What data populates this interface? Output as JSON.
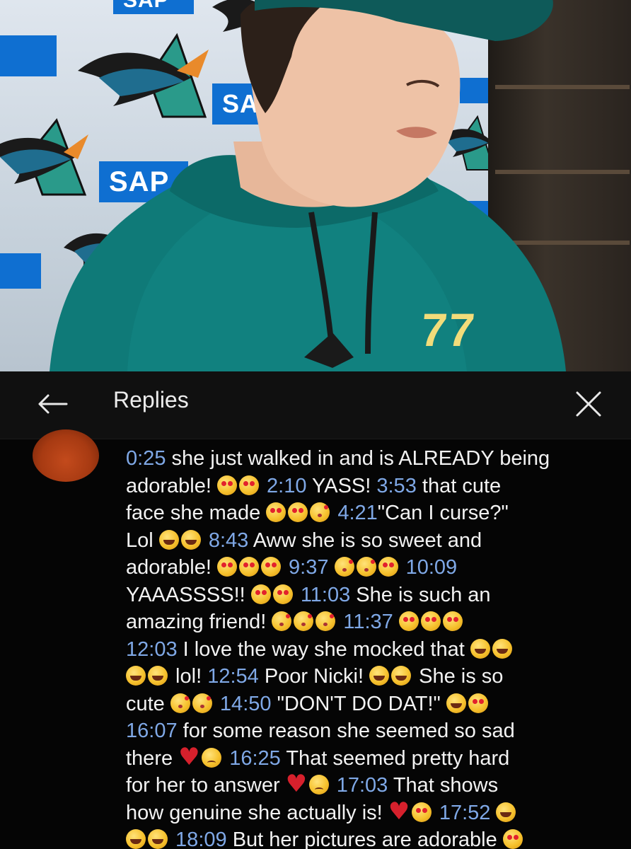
{
  "photo": {
    "sponsor_text": "SAP",
    "jersey_number": "77",
    "colors": {
      "hoodie": "#0f7a78",
      "sap_blue": "#0f6fd1",
      "backdrop": "#d3dce5"
    }
  },
  "header": {
    "back_icon": "arrow-left-icon",
    "title": "Replies",
    "close_icon": "close-icon"
  },
  "comment": {
    "author_initials": "",
    "lines": [
      [
        {
          "t": "ts",
          "v": "0:25"
        },
        {
          "t": "txt",
          "v": " she just walked in and is ALREADY being"
        }
      ],
      [
        {
          "t": "txt",
          "v": "adorable! "
        },
        {
          "t": "emo",
          "v": "love"
        },
        {
          "t": "emo",
          "v": "love"
        },
        {
          "t": "ts",
          "v": " 2:10"
        },
        {
          "t": "txt",
          "v": " YASS! "
        },
        {
          "t": "ts",
          "v": "3:53"
        },
        {
          "t": "txt",
          "v": " that cute"
        }
      ],
      [
        {
          "t": "txt",
          "v": "face she made "
        },
        {
          "t": "emo",
          "v": "love"
        },
        {
          "t": "emo",
          "v": "love"
        },
        {
          "t": "emo",
          "v": "kiss"
        },
        {
          "t": "ts",
          "v": " 4:21"
        },
        {
          "t": "txt",
          "v": "\"Can I curse?\""
        }
      ],
      [
        {
          "t": "txt",
          "v": "Lol "
        },
        {
          "t": "emo",
          "v": "laugh"
        },
        {
          "t": "emo",
          "v": "laugh"
        },
        {
          "t": "ts",
          "v": " 8:43"
        },
        {
          "t": "txt",
          "v": " Aww she is so sweet and"
        }
      ],
      [
        {
          "t": "txt",
          "v": "adorable! "
        },
        {
          "t": "emo",
          "v": "love"
        },
        {
          "t": "emo",
          "v": "love"
        },
        {
          "t": "emo",
          "v": "love"
        },
        {
          "t": "ts",
          "v": " 9:37 "
        },
        {
          "t": "emo",
          "v": "kiss"
        },
        {
          "t": "emo",
          "v": "kiss"
        },
        {
          "t": "emo",
          "v": "love"
        },
        {
          "t": "ts",
          "v": " 10:09"
        }
      ],
      [
        {
          "t": "txt",
          "v": "YAAASSSS!! "
        },
        {
          "t": "emo",
          "v": "love"
        },
        {
          "t": "emo",
          "v": "love"
        },
        {
          "t": "ts",
          "v": " 11:03"
        },
        {
          "t": "txt",
          "v": " She is such an"
        }
      ],
      [
        {
          "t": "txt",
          "v": "amazing friend! "
        },
        {
          "t": "emo",
          "v": "kiss"
        },
        {
          "t": "emo",
          "v": "kiss"
        },
        {
          "t": "emo",
          "v": "kiss"
        },
        {
          "t": "ts",
          "v": " 11:37 "
        },
        {
          "t": "emo",
          "v": "love"
        },
        {
          "t": "emo",
          "v": "love"
        },
        {
          "t": "emo",
          "v": "love"
        }
      ],
      [
        {
          "t": "ts",
          "v": "12:03"
        },
        {
          "t": "txt",
          "v": " I love the way she mocked that "
        },
        {
          "t": "emo",
          "v": "laugh"
        },
        {
          "t": "emo",
          "v": "laugh"
        }
      ],
      [
        {
          "t": "emo",
          "v": "laugh"
        },
        {
          "t": "emo",
          "v": "laugh"
        },
        {
          "t": "txt",
          "v": " lol! "
        },
        {
          "t": "ts",
          "v": "12:54"
        },
        {
          "t": "txt",
          "v": " Poor Nicki! "
        },
        {
          "t": "emo",
          "v": "laugh"
        },
        {
          "t": "emo",
          "v": "laugh"
        },
        {
          "t": "txt",
          "v": " She is so"
        }
      ],
      [
        {
          "t": "txt",
          "v": "cute "
        },
        {
          "t": "emo",
          "v": "kiss"
        },
        {
          "t": "emo",
          "v": "kiss"
        },
        {
          "t": "ts",
          "v": " 14:50"
        },
        {
          "t": "txt",
          "v": " \"DON'T DO DAT!\" "
        },
        {
          "t": "emo",
          "v": "laugh"
        },
        {
          "t": "emo",
          "v": "love"
        }
      ],
      [
        {
          "t": "ts",
          "v": "16:07"
        },
        {
          "t": "txt",
          "v": " for some reason she seemed so sad"
        }
      ],
      [
        {
          "t": "txt",
          "v": "there "
        },
        {
          "t": "emo",
          "v": "heart"
        },
        {
          "t": "emo",
          "v": "sad"
        },
        {
          "t": "ts",
          "v": " 16:25"
        },
        {
          "t": "txt",
          "v": " That seemed pretty hard"
        }
      ],
      [
        {
          "t": "txt",
          "v": "for her to answer "
        },
        {
          "t": "emo",
          "v": "heart"
        },
        {
          "t": "emo",
          "v": "sad"
        },
        {
          "t": "ts",
          "v": " 17:03"
        },
        {
          "t": "txt",
          "v": " That shows"
        }
      ],
      [
        {
          "t": "txt",
          "v": "how genuine she actually is! "
        },
        {
          "t": "emo",
          "v": "heart"
        },
        {
          "t": "emo",
          "v": "love"
        },
        {
          "t": "ts",
          "v": " 17:52 "
        },
        {
          "t": "emo",
          "v": "laugh"
        }
      ],
      [
        {
          "t": "emo",
          "v": "laugh"
        },
        {
          "t": "emo",
          "v": "laugh"
        },
        {
          "t": "ts",
          "v": " 18:09"
        },
        {
          "t": "txt",
          "v": " But her pictures are adorable "
        },
        {
          "t": "emo",
          "v": "love"
        }
      ]
    ]
  }
}
